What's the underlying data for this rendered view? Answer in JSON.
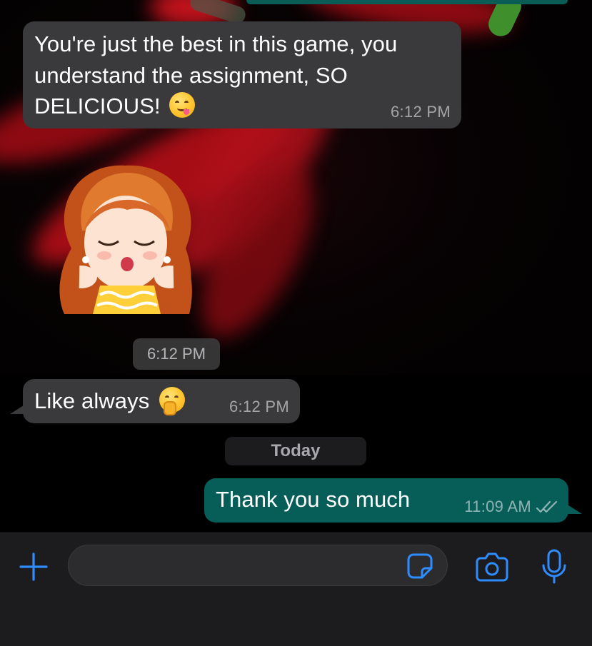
{
  "conversation": {
    "messages": [
      {
        "direction": "incoming",
        "text_line1": "You're just the best in this game, you",
        "text_line2": "understand the assignment, SO",
        "text_line3": "DELICIOUS!",
        "emoji": "face-savoring-food-emoji",
        "time": "6:12 PM"
      },
      {
        "direction": "incoming",
        "type": "sticker",
        "sticker": "cartoon-girl-sticker",
        "time": "6:12 PM"
      },
      {
        "direction": "incoming",
        "text": "Like always",
        "emoji": "face-with-hand-over-mouth-emoji",
        "time": "6:12 PM"
      },
      {
        "direction": "outgoing",
        "text": "Thank you so much",
        "time": "11:09 AM",
        "status": "read-double-check"
      }
    ],
    "date_separator": "Today"
  },
  "input_bar": {
    "placeholder": "",
    "icons": [
      "plus-icon",
      "sticker-icon",
      "camera-icon",
      "microphone-icon"
    ]
  },
  "colors": {
    "incoming_bubble": "#3a3a3c",
    "outgoing_bubble": "#075e58",
    "accent": "#2f8cff",
    "input_bar_bg": "#1c1c1e"
  }
}
